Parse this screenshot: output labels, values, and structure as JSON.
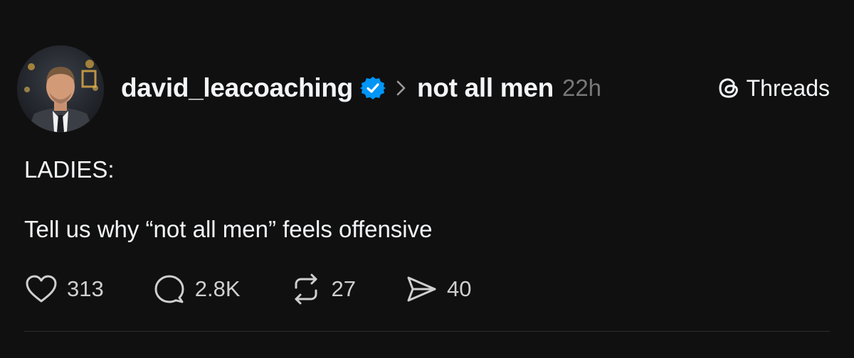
{
  "post": {
    "username": "david_leacoaching",
    "topic": "not all men",
    "timestamp": "22h",
    "brand_label": "Threads",
    "body": [
      "LADIES:",
      "Tell us why “not all men” feels offensive"
    ],
    "actions": {
      "like": {
        "icon": "heart-icon",
        "count": "313"
      },
      "reply": {
        "icon": "comment-icon",
        "count": "2.8K"
      },
      "repost": {
        "icon": "repost-icon",
        "count": "27"
      },
      "share": {
        "icon": "send-icon",
        "count": "40"
      }
    }
  },
  "colors": {
    "background": "#101010",
    "text": "#f3f5f7",
    "muted": "#777777",
    "verified": "#0095f6"
  }
}
